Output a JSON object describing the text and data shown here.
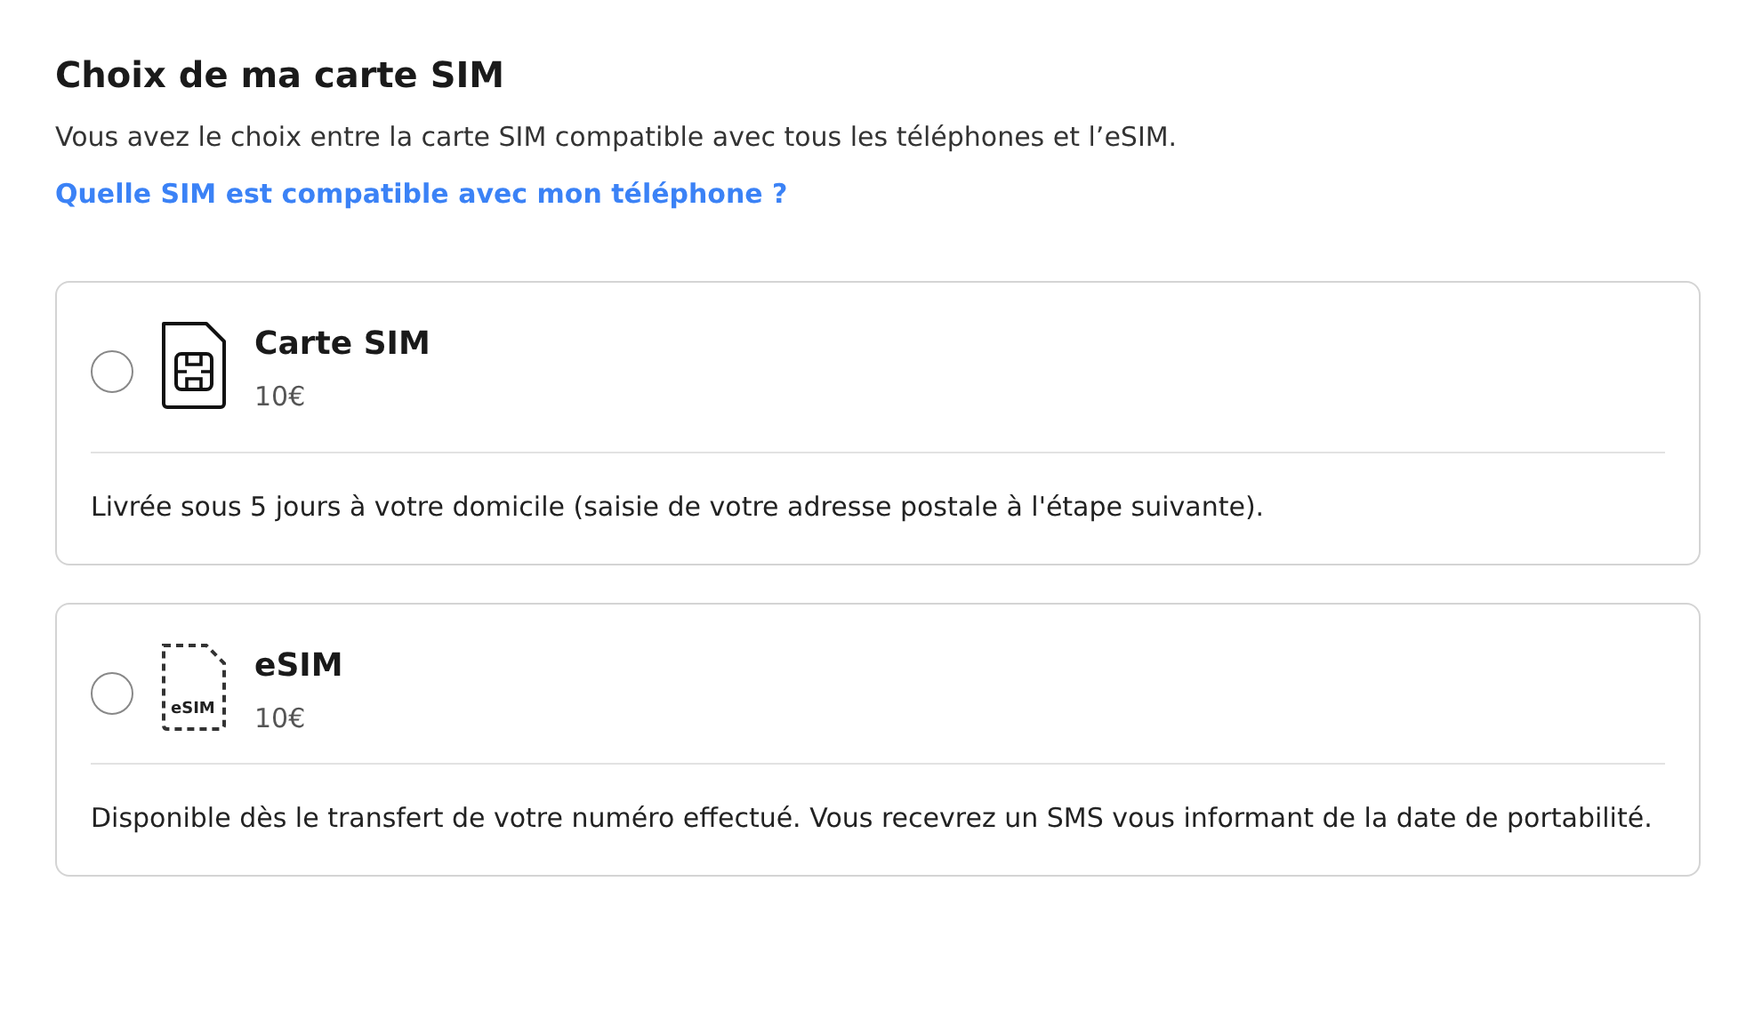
{
  "title": "Choix de ma carte SIM",
  "intro": "Vous avez le choix entre la carte SIM compatible avec tous les téléphones et l’eSIM.",
  "help_link": "Quelle SIM est compatible avec mon téléphone ?",
  "options": [
    {
      "kind": "physical",
      "name": "Carte SIM",
      "price": "10€",
      "selected": false,
      "description": "Livrée sous 5 jours à votre domicile (saisie de votre adresse postale à l'étape suivante)."
    },
    {
      "kind": "esim",
      "name": "eSIM",
      "icon_label": "eSIM",
      "price": "10€",
      "selected": false,
      "description": "Disponible dès le transfert de votre numéro effectué. Vous recevrez un SMS vous informant de la date de portabilité."
    }
  ]
}
